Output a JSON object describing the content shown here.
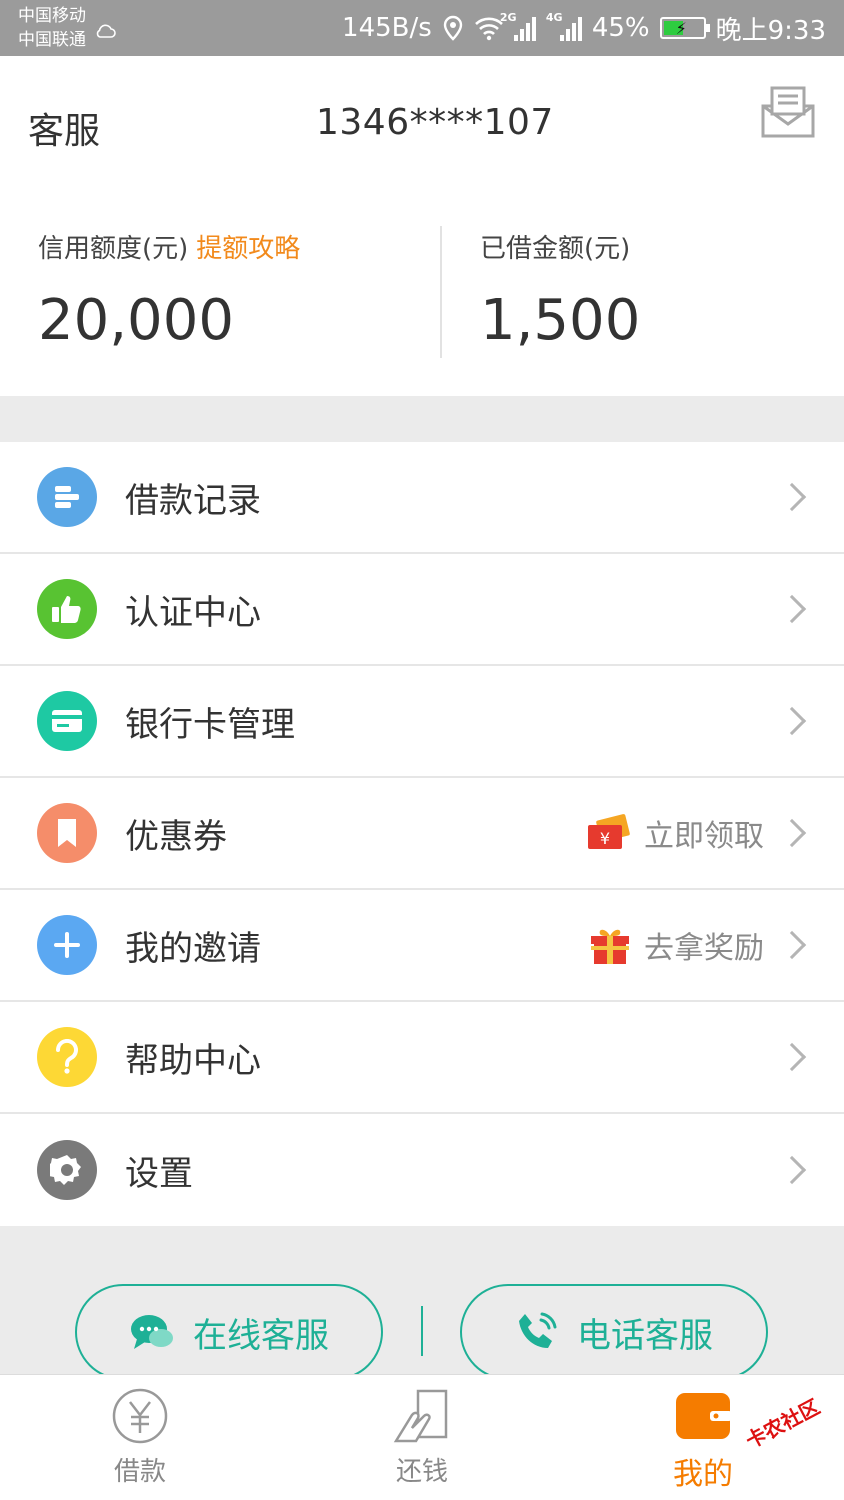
{
  "status_bar": {
    "carrier_1": "中国移动",
    "carrier_2": "中国联通",
    "speed": "145B/s",
    "net_1": "2G",
    "net_2": "4G",
    "battery": "45%",
    "time": "晚上9:33"
  },
  "header": {
    "service_label": "客服",
    "phone": "1346****107",
    "credit_label": "信用额度(元)",
    "credit_link": "提额攻略",
    "credit_value": "20,000",
    "borrowed_label": "已借金额(元)",
    "borrowed_value": "1,500"
  },
  "menu": {
    "items": [
      {
        "label": "借款记录",
        "icon": "list-icon",
        "color": "#5aa7e6"
      },
      {
        "label": "认证中心",
        "icon": "thumbs-up-icon",
        "color": "#58c332"
      },
      {
        "label": "银行卡管理",
        "icon": "bank-card-icon",
        "color": "#1ec9a3"
      },
      {
        "label": "优惠券",
        "icon": "bookmark-icon",
        "color": "#f58d6a",
        "extra": "立即领取",
        "extra_icon": "coupon-ticket-icon"
      },
      {
        "label": "我的邀请",
        "icon": "plus-icon",
        "color": "#5ba8f2",
        "extra": "去拿奖励",
        "extra_icon": "gift-icon"
      },
      {
        "label": "帮助中心",
        "icon": "question-icon",
        "color": "#fdd835"
      },
      {
        "label": "设置",
        "icon": "gear-icon",
        "color": "#7a7a7a"
      }
    ]
  },
  "service": {
    "online": "在线客服",
    "phone": "电话客服",
    "accent": "#1eb096"
  },
  "tabs": {
    "loan": "借款",
    "repay": "还钱",
    "mine": "我的",
    "active_color": "#f57c00"
  },
  "watermark": "卡农社区"
}
